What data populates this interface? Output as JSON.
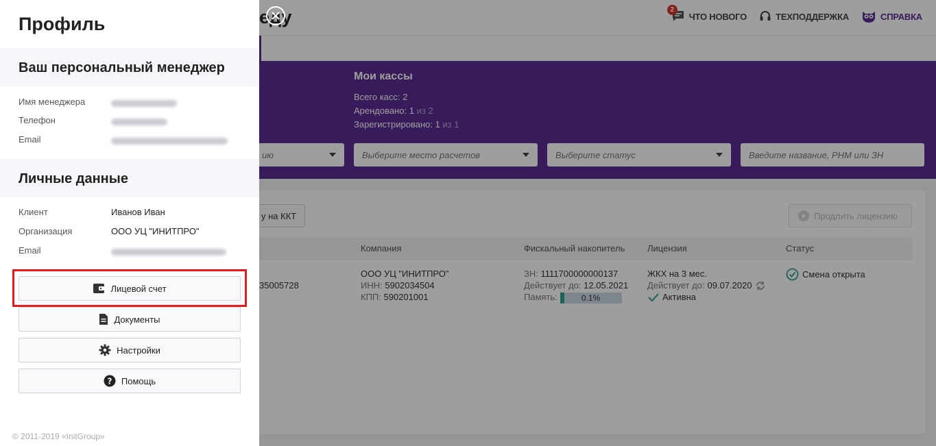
{
  "app": {
    "page_title": "еду",
    "top_links": {
      "news": "ЧТО НОВОГО",
      "news_badge": "2",
      "support": "ТЕХПОДДЕРЖКА",
      "help": "СПРАВКА"
    },
    "hero": {
      "title": "Мои кассы",
      "total_label": "Всего касс:",
      "total_value": "2",
      "rented_label": "Арендовано:",
      "rented_value": "1",
      "rented_of": "из 2",
      "registered_label": "Зарегистрировано:",
      "registered_value": "1",
      "registered_of": "из 1"
    },
    "filters": {
      "first": "ию",
      "place": "Выберите место расчетов",
      "status": "Выберите статус",
      "search_placeholder": "Введите название, РНМ или ЗН"
    },
    "toolbar": {
      "add_button": "у на ККТ",
      "renew_button": "Продлить лицензию"
    },
    "table": {
      "headers": [
        "Компания",
        "Фискальный накопитель",
        "Лицензия",
        "Статус"
      ],
      "row": {
        "reg_number": "35005728",
        "company_name": "ООО УЦ \"ИНИТПРО\"",
        "inn_label": "ИНН:",
        "inn": "5902034504",
        "kpp_label": "КПП:",
        "kpp": "590201001",
        "fn_label": "ЗН:",
        "fn_number": "1111700000000137",
        "fn_valid_label": "Действует до:",
        "fn_valid": "12.05.2021",
        "memory_label": "Память:",
        "memory_value": "0.1%",
        "memory_fraction": 0.1,
        "license_name": "ЖКХ на 3 мес.",
        "license_valid_label": "Действует до:",
        "license_valid": "09.07.2020",
        "license_status": "Активна",
        "status": "Смена открыта"
      }
    }
  },
  "profile": {
    "title": "Профиль",
    "manager_section": "Ваш персональный менеджер",
    "manager_name_label": "Имя менеджера",
    "manager_phone_label": "Телефон",
    "manager_email_label": "Email",
    "personal_section": "Личные данные",
    "client_label": "Клиент",
    "client_value": "Иванов Иван",
    "org_label": "Организация",
    "org_value": "ООО УЦ \"ИНИТПРО\"",
    "email_label": "Email",
    "menu": {
      "account": "Лицевой счет",
      "documents": "Документы",
      "settings": "Настройки",
      "help": "Помощь"
    },
    "copyright": "© 2011-2019 «InitGroup»"
  },
  "colors": {
    "brand": "#5b2d91",
    "highlight": "#e21b1b",
    "success": "#2aa08a"
  }
}
